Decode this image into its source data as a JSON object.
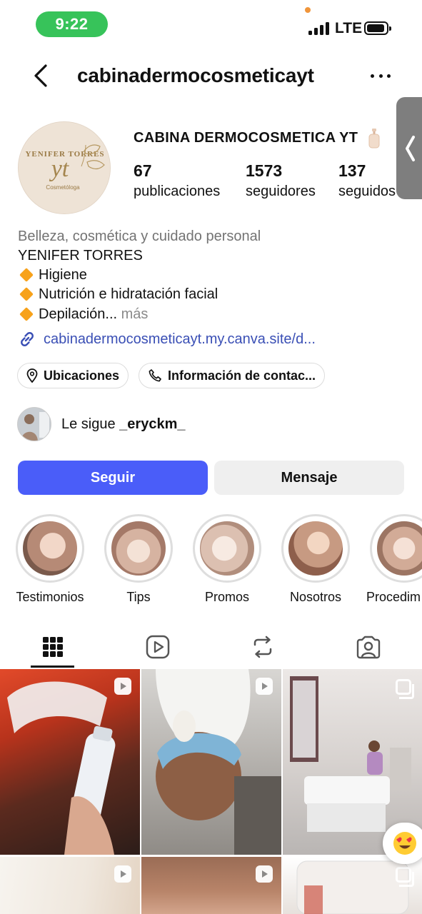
{
  "status_bar": {
    "time": "9:22",
    "network": "LTE"
  },
  "header": {
    "username": "cabinadermocosmeticayt"
  },
  "profile": {
    "display_name": "CABINA DERMOCOSMETICA YT",
    "avatar_text": {
      "top": "YENIFER TORRES",
      "mono": "yt",
      "sub": "Cosmetóloga"
    },
    "stats": [
      {
        "value": "67",
        "label": "publicaciones"
      },
      {
        "value": "1573",
        "label": "seguidores"
      },
      {
        "value": "137",
        "label": "seguidos"
      }
    ],
    "category": "Belleza, cosmética y cuidado personal",
    "bio": [
      "YENIFER TORRES",
      "Higiene",
      "Nutrición e hidratación facial",
      "Depilación..."
    ],
    "bio_more": " más",
    "link": "cabinadermocosmeticayt.my.canva.site/d...",
    "chips": {
      "location": "Ubicaciones",
      "contact": "Información de contac..."
    },
    "followed_by": {
      "prefix": "Le sigue ",
      "user": "_eryckm_"
    }
  },
  "actions": {
    "follow": "Seguir",
    "message": "Mensaje"
  },
  "highlights": [
    {
      "label": "Testimonios"
    },
    {
      "label": "Tips"
    },
    {
      "label": "Promos"
    },
    {
      "label": "Nosotros"
    },
    {
      "label": "Procedim"
    }
  ],
  "tabs": [
    "grid-icon",
    "reels-icon",
    "reposts-icon",
    "tagged-icon"
  ],
  "colors": {
    "accent": "#4a5df9",
    "time_pill": "#37c35a",
    "link": "#3a4fb5",
    "bio_bullet": "#f7a21b"
  },
  "grid_posts": [
    {
      "type": "reel"
    },
    {
      "type": "reel"
    },
    {
      "type": "carousel"
    },
    {
      "type": "reel"
    },
    {
      "type": "reel"
    },
    {
      "type": "carousel"
    }
  ]
}
